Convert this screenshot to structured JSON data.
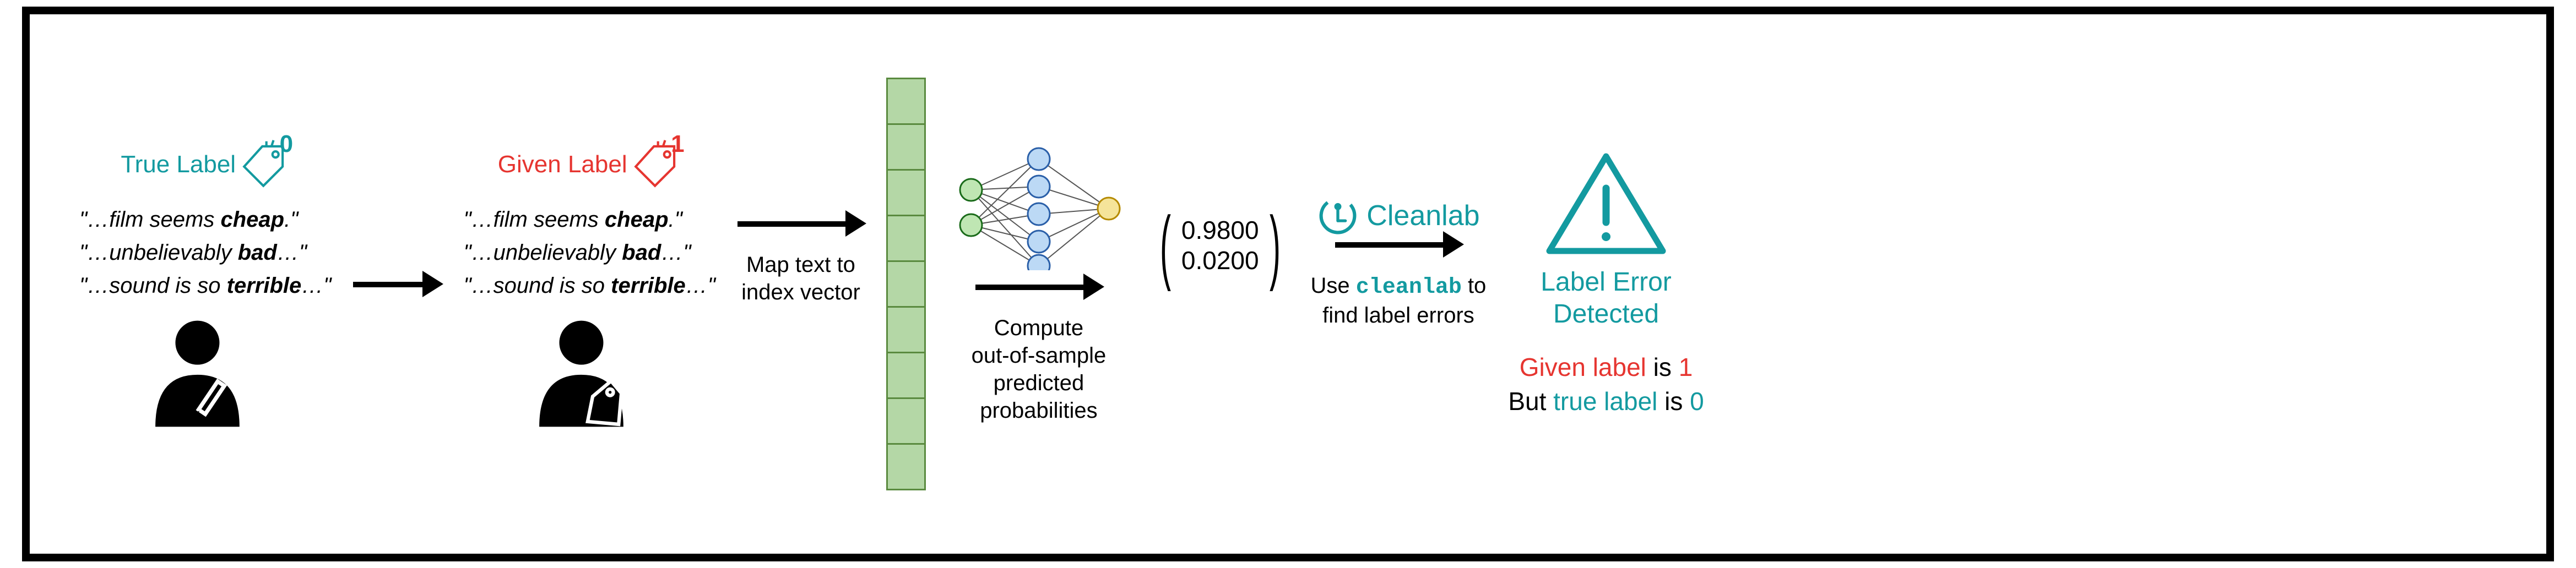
{
  "stage_true": {
    "tag_text": "True Label",
    "tag_value": "0",
    "q1_a": "\"…film seems ",
    "q1_b": "cheap",
    "q1_c": ".\"",
    "q2_a": "\"…unbelievably ",
    "q2_b": "bad",
    "q2_c": "…\"",
    "q3_a": "\"…sound is so ",
    "q3_b": "terrible",
    "q3_c": "…\""
  },
  "stage_given": {
    "tag_text": "Given Label",
    "tag_value": "1",
    "q1_a": "\"…film seems ",
    "q1_b": "cheap",
    "q1_c": ".\"",
    "q2_a": "\"…unbelievably ",
    "q2_b": "bad",
    "q2_c": "…\"",
    "q3_a": "\"…sound is so ",
    "q3_b": "terrible",
    "q3_c": "…\""
  },
  "arrow_map": {
    "l1": "Map text to",
    "l2": "index vector"
  },
  "arrow_compute": {
    "l1": "Compute",
    "l2": "out-of-sample",
    "l3": "predicted",
    "l4": "probabilities"
  },
  "probs": {
    "p0": "0.9800",
    "p1": "0.0200"
  },
  "cleanlab": {
    "name": "Cleanlab",
    "l1_a": "Use ",
    "l1_b": "cleanlab",
    "l1_c": " to",
    "l2": "find label errors"
  },
  "result": {
    "title_l1": "Label Error",
    "title_l2": "Detected",
    "l1_a": "Given label",
    "l1_b": " is ",
    "l1_c": "1",
    "l2_a": "But ",
    "l2_b": "true label",
    "l2_c": " is ",
    "l2_d": "0"
  }
}
